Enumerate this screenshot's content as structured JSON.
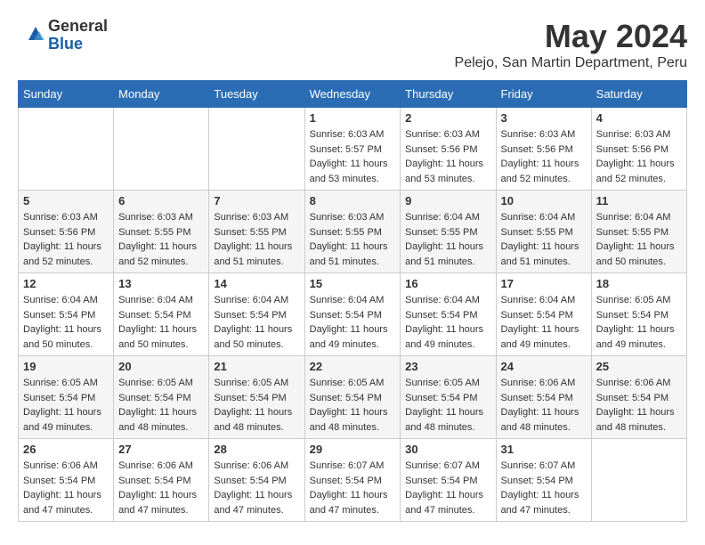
{
  "header": {
    "logo_general": "General",
    "logo_blue": "Blue",
    "month_title": "May 2024",
    "location": "Pelejo, San Martin Department, Peru"
  },
  "weekdays": [
    "Sunday",
    "Monday",
    "Tuesday",
    "Wednesday",
    "Thursday",
    "Friday",
    "Saturday"
  ],
  "weeks": [
    [
      {
        "day": "",
        "info": ""
      },
      {
        "day": "",
        "info": ""
      },
      {
        "day": "",
        "info": ""
      },
      {
        "day": "1",
        "info": "Sunrise: 6:03 AM\nSunset: 5:57 PM\nDaylight: 11 hours and 53 minutes."
      },
      {
        "day": "2",
        "info": "Sunrise: 6:03 AM\nSunset: 5:56 PM\nDaylight: 11 hours and 53 minutes."
      },
      {
        "day": "3",
        "info": "Sunrise: 6:03 AM\nSunset: 5:56 PM\nDaylight: 11 hours and 52 minutes."
      },
      {
        "day": "4",
        "info": "Sunrise: 6:03 AM\nSunset: 5:56 PM\nDaylight: 11 hours and 52 minutes."
      }
    ],
    [
      {
        "day": "5",
        "info": "Sunrise: 6:03 AM\nSunset: 5:56 PM\nDaylight: 11 hours and 52 minutes."
      },
      {
        "day": "6",
        "info": "Sunrise: 6:03 AM\nSunset: 5:55 PM\nDaylight: 11 hours and 52 minutes."
      },
      {
        "day": "7",
        "info": "Sunrise: 6:03 AM\nSunset: 5:55 PM\nDaylight: 11 hours and 51 minutes."
      },
      {
        "day": "8",
        "info": "Sunrise: 6:03 AM\nSunset: 5:55 PM\nDaylight: 11 hours and 51 minutes."
      },
      {
        "day": "9",
        "info": "Sunrise: 6:04 AM\nSunset: 5:55 PM\nDaylight: 11 hours and 51 minutes."
      },
      {
        "day": "10",
        "info": "Sunrise: 6:04 AM\nSunset: 5:55 PM\nDaylight: 11 hours and 51 minutes."
      },
      {
        "day": "11",
        "info": "Sunrise: 6:04 AM\nSunset: 5:55 PM\nDaylight: 11 hours and 50 minutes."
      }
    ],
    [
      {
        "day": "12",
        "info": "Sunrise: 6:04 AM\nSunset: 5:54 PM\nDaylight: 11 hours and 50 minutes."
      },
      {
        "day": "13",
        "info": "Sunrise: 6:04 AM\nSunset: 5:54 PM\nDaylight: 11 hours and 50 minutes."
      },
      {
        "day": "14",
        "info": "Sunrise: 6:04 AM\nSunset: 5:54 PM\nDaylight: 11 hours and 50 minutes."
      },
      {
        "day": "15",
        "info": "Sunrise: 6:04 AM\nSunset: 5:54 PM\nDaylight: 11 hours and 49 minutes."
      },
      {
        "day": "16",
        "info": "Sunrise: 6:04 AM\nSunset: 5:54 PM\nDaylight: 11 hours and 49 minutes."
      },
      {
        "day": "17",
        "info": "Sunrise: 6:04 AM\nSunset: 5:54 PM\nDaylight: 11 hours and 49 minutes."
      },
      {
        "day": "18",
        "info": "Sunrise: 6:05 AM\nSunset: 5:54 PM\nDaylight: 11 hours and 49 minutes."
      }
    ],
    [
      {
        "day": "19",
        "info": "Sunrise: 6:05 AM\nSunset: 5:54 PM\nDaylight: 11 hours and 49 minutes."
      },
      {
        "day": "20",
        "info": "Sunrise: 6:05 AM\nSunset: 5:54 PM\nDaylight: 11 hours and 48 minutes."
      },
      {
        "day": "21",
        "info": "Sunrise: 6:05 AM\nSunset: 5:54 PM\nDaylight: 11 hours and 48 minutes."
      },
      {
        "day": "22",
        "info": "Sunrise: 6:05 AM\nSunset: 5:54 PM\nDaylight: 11 hours and 48 minutes."
      },
      {
        "day": "23",
        "info": "Sunrise: 6:05 AM\nSunset: 5:54 PM\nDaylight: 11 hours and 48 minutes."
      },
      {
        "day": "24",
        "info": "Sunrise: 6:06 AM\nSunset: 5:54 PM\nDaylight: 11 hours and 48 minutes."
      },
      {
        "day": "25",
        "info": "Sunrise: 6:06 AM\nSunset: 5:54 PM\nDaylight: 11 hours and 48 minutes."
      }
    ],
    [
      {
        "day": "26",
        "info": "Sunrise: 6:06 AM\nSunset: 5:54 PM\nDaylight: 11 hours and 47 minutes."
      },
      {
        "day": "27",
        "info": "Sunrise: 6:06 AM\nSunset: 5:54 PM\nDaylight: 11 hours and 47 minutes."
      },
      {
        "day": "28",
        "info": "Sunrise: 6:06 AM\nSunset: 5:54 PM\nDaylight: 11 hours and 47 minutes."
      },
      {
        "day": "29",
        "info": "Sunrise: 6:07 AM\nSunset: 5:54 PM\nDaylight: 11 hours and 47 minutes."
      },
      {
        "day": "30",
        "info": "Sunrise: 6:07 AM\nSunset: 5:54 PM\nDaylight: 11 hours and 47 minutes."
      },
      {
        "day": "31",
        "info": "Sunrise: 6:07 AM\nSunset: 5:54 PM\nDaylight: 11 hours and 47 minutes."
      },
      {
        "day": "",
        "info": ""
      }
    ]
  ]
}
